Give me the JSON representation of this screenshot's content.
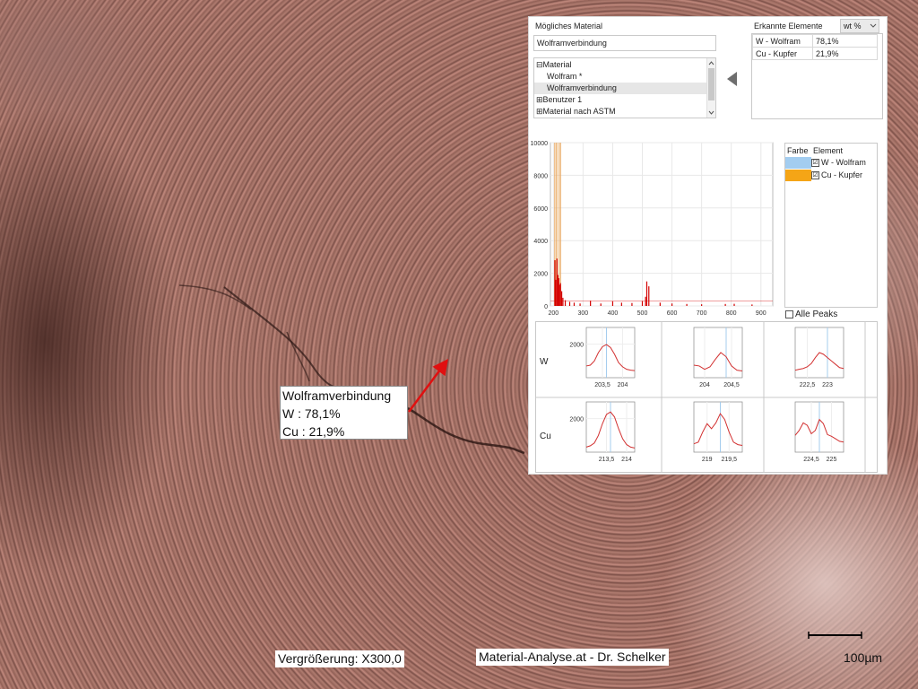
{
  "analysis_panel": {
    "possible_material_label": "Mögliches Material",
    "possible_material_value": "Wolframverbindung",
    "tree": {
      "items": [
        {
          "label": "Material",
          "expander": "⊟"
        },
        {
          "label": "Wolfram *"
        },
        {
          "label": "Wolframverbindung",
          "selected": true
        },
        {
          "label": "Benutzer 1",
          "expander": "⊞"
        },
        {
          "label": "Material nach ASTM",
          "expander": "⊞"
        }
      ]
    },
    "detected_elements_label": "Erkannte Elemente",
    "unit_select": "wt %",
    "detected_elements": [
      {
        "element": "W - Wolfram",
        "value": "78,1%"
      },
      {
        "element": "Cu - Kupfer",
        "value": "21,9%"
      }
    ],
    "legend": {
      "col_color": "Farbe",
      "col_element": "Element",
      "items": [
        {
          "name": "W - Wolfram",
          "color": "#a3cdf0",
          "checked": "☑"
        },
        {
          "name": "Cu - Kupfer",
          "color": "#f5a516",
          "checked": "☑"
        }
      ]
    },
    "all_peaks_label": "Alle Peaks",
    "row_labels": [
      "W",
      "Cu"
    ]
  },
  "chart_data": [
    {
      "type": "line",
      "title": "",
      "xlabel": "",
      "ylabel": "",
      "xlim": [
        190,
        940
      ],
      "ylim": [
        0,
        10000
      ],
      "x_ticks": [
        "200",
        "300",
        "400",
        "500",
        "600",
        "700",
        "800",
        "900"
      ],
      "y_ticks": [
        "0",
        "2000",
        "4000",
        "6000",
        "8000",
        "10000"
      ],
      "series_color": "#d40000",
      "peaks": [
        {
          "x": 205,
          "y": 2800
        },
        {
          "x": 208,
          "y": 1600
        },
        {
          "x": 212,
          "y": 2900
        },
        {
          "x": 215,
          "y": 1900
        },
        {
          "x": 218,
          "y": 1700
        },
        {
          "x": 220,
          "y": 1300
        },
        {
          "x": 224,
          "y": 1400
        },
        {
          "x": 228,
          "y": 900
        },
        {
          "x": 232,
          "y": 500
        },
        {
          "x": 240,
          "y": 350
        },
        {
          "x": 255,
          "y": 250
        },
        {
          "x": 270,
          "y": 200
        },
        {
          "x": 290,
          "y": 150
        },
        {
          "x": 325,
          "y": 320
        },
        {
          "x": 360,
          "y": 150
        },
        {
          "x": 400,
          "y": 280
        },
        {
          "x": 430,
          "y": 200
        },
        {
          "x": 465,
          "y": 180
        },
        {
          "x": 500,
          "y": 300
        },
        {
          "x": 511,
          "y": 560
        },
        {
          "x": 515,
          "y": 1500
        },
        {
          "x": 522,
          "y": 1200
        },
        {
          "x": 560,
          "y": 200
        },
        {
          "x": 600,
          "y": 150
        },
        {
          "x": 650,
          "y": 120
        },
        {
          "x": 700,
          "y": 100
        },
        {
          "x": 780,
          "y": 120
        },
        {
          "x": 810,
          "y": 130
        },
        {
          "x": 870,
          "y": 90
        }
      ],
      "marker_lines_x": [
        203.5,
        207.9,
        209.5,
        213.6,
        219.3,
        223.0,
        224.7
      ]
    },
    {
      "type": "line",
      "panel": "W-1",
      "x_ticks": [
        "203,5",
        "204"
      ],
      "y_ticks": [
        "2000"
      ],
      "xlim": [
        203.1,
        204.3
      ],
      "ylim": [
        0,
        3000
      ],
      "x": [
        203.1,
        203.2,
        203.3,
        203.4,
        203.5,
        203.6,
        203.7,
        203.8,
        203.9,
        204.0,
        204.1,
        204.2,
        204.3
      ],
      "y": [
        700,
        750,
        1000,
        1500,
        1850,
        1980,
        1800,
        1400,
        900,
        650,
        500,
        450,
        420
      ],
      "marker_x": 203.6
    },
    {
      "type": "line",
      "panel": "W-2",
      "x_ticks": [
        "204",
        "204,5"
      ],
      "y_ticks": [],
      "xlim": [
        203.8,
        204.7
      ],
      "ylim": [
        0,
        3000
      ],
      "x": [
        203.8,
        203.9,
        204.0,
        204.1,
        204.2,
        204.3,
        204.4,
        204.5,
        204.6,
        204.7
      ],
      "y": [
        750,
        700,
        500,
        650,
        1100,
        1500,
        1250,
        700,
        450,
        400
      ],
      "marker_x": 204.4
    },
    {
      "type": "line",
      "panel": "W-3",
      "x_ticks": [
        "222,5",
        "223"
      ],
      "y_ticks": [],
      "xlim": [
        222.2,
        223.4
      ],
      "ylim": [
        0,
        3000
      ],
      "x": [
        222.2,
        222.3,
        222.4,
        222.5,
        222.6,
        222.7,
        222.8,
        222.9,
        223.0,
        223.1,
        223.2,
        223.3,
        223.4
      ],
      "y": [
        450,
        500,
        550,
        650,
        850,
        1200,
        1500,
        1400,
        1200,
        1000,
        800,
        600,
        550
      ],
      "marker_x": 223.0
    },
    {
      "type": "line",
      "panel": "Cu-1",
      "x_ticks": [
        "213,5",
        "214"
      ],
      "y_ticks": [
        "2000"
      ],
      "xlim": [
        213.0,
        214.2
      ],
      "ylim": [
        0,
        3000
      ],
      "x": [
        213.0,
        213.1,
        213.2,
        213.3,
        213.4,
        213.5,
        213.6,
        213.7,
        213.8,
        213.9,
        214.0,
        214.1,
        214.2
      ],
      "y": [
        300,
        380,
        550,
        1000,
        1700,
        2250,
        2400,
        2100,
        1400,
        800,
        450,
        300,
        250
      ],
      "marker_x": 213.6
    },
    {
      "type": "line",
      "panel": "Cu-2",
      "x_ticks": [
        "219",
        "219,5"
      ],
      "y_ticks": [],
      "xlim": [
        218.7,
        219.8
      ],
      "ylim": [
        0,
        3000
      ],
      "x": [
        218.7,
        218.8,
        218.9,
        219.0,
        219.1,
        219.2,
        219.3,
        219.4,
        219.5,
        219.6,
        219.7,
        219.8
      ],
      "y": [
        500,
        600,
        1200,
        1700,
        1400,
        1750,
        2300,
        1950,
        1200,
        600,
        450,
        400
      ],
      "marker_x": 219.3
    },
    {
      "type": "line",
      "panel": "Cu-3",
      "x_ticks": [
        "224,5",
        "225"
      ],
      "y_ticks": [],
      "xlim": [
        224.1,
        225.3
      ],
      "ylim": [
        0,
        3000
      ],
      "x": [
        224.1,
        224.2,
        224.3,
        224.4,
        224.5,
        224.6,
        224.7,
        224.8,
        224.9,
        225.0,
        225.1,
        225.2,
        225.3
      ],
      "y": [
        1000,
        1300,
        1750,
        1600,
        1100,
        1300,
        1950,
        1700,
        1050,
        950,
        800,
        650,
        600
      ],
      "marker_x": 224.7
    }
  ],
  "overlay": {
    "material": "Wolframverbindung",
    "line1": "W : 78,1%",
    "line2": "Cu : 21,9%",
    "arrow_color": "#e01010"
  },
  "footer": {
    "magnification": "Vergrößerung: X300,0",
    "credit": "Material-Analyse.at - Dr. Schelker",
    "scale": "100µm"
  }
}
